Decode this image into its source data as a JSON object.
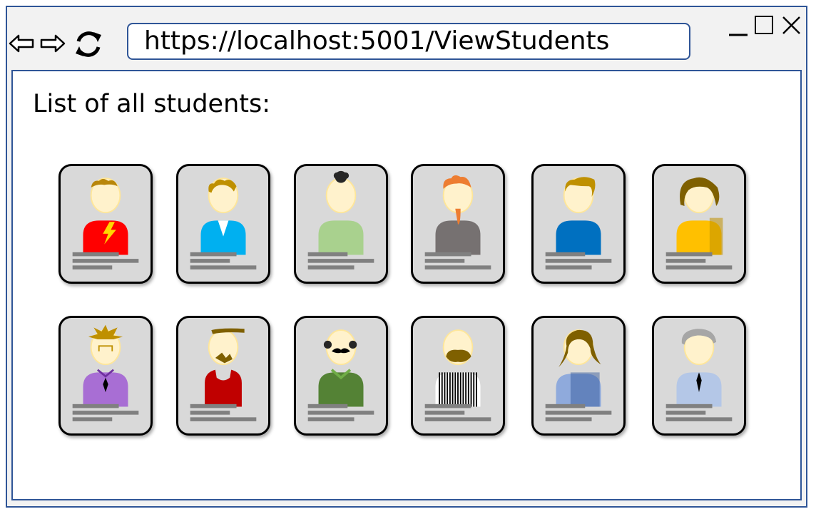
{
  "browser": {
    "url": "https://localhost:5001/ViewStudents",
    "nav_icons": [
      "back-arrow-icon",
      "forward-arrow-icon",
      "refresh-icon"
    ],
    "window_icons": [
      "minimize-icon",
      "maximize-icon",
      "close-icon"
    ]
  },
  "page": {
    "title": "List of all students:"
  },
  "students": [
    {
      "avatar": "avatar-red-lightning-shirt",
      "shirt": "#ff0000",
      "hair": "#b8860b"
    },
    {
      "avatar": "avatar-blue-shirt",
      "shirt": "#00b0f0",
      "hair": "#bf9000"
    },
    {
      "avatar": "avatar-green-shirt-bun",
      "shirt": "#a9d18e",
      "hair": "#262626"
    },
    {
      "avatar": "avatar-grey-shirt-orange-beard",
      "shirt": "#767171",
      "hair": "#ed7d31"
    },
    {
      "avatar": "avatar-blue-shirt-ponytail",
      "shirt": "#0070c0",
      "hair": "#bf9000"
    },
    {
      "avatar": "avatar-gold-shirt-curly",
      "shirt": "#ffc000",
      "hair": "#7f6000"
    },
    {
      "avatar": "avatar-purple-shirt-tie",
      "shirt": "#a86ed4",
      "hair": "#bf9000"
    },
    {
      "avatar": "avatar-red-tank-headband",
      "shirt": "#c00000",
      "hair": "#7f6000"
    },
    {
      "avatar": "avatar-green-sweater-mustache",
      "shirt": "#548235",
      "hair": "#262626"
    },
    {
      "avatar": "avatar-striped-shirt-beard",
      "shirt": "#ffffff",
      "hair": "#7f6000"
    },
    {
      "avatar": "avatar-blue-gradient-shirt",
      "shirt": "#8faadc",
      "hair": "#7f6000"
    },
    {
      "avatar": "avatar-light-blue-shirt-tie",
      "shirt": "#b4c7e7",
      "hair": "#a6a6a6"
    }
  ]
}
